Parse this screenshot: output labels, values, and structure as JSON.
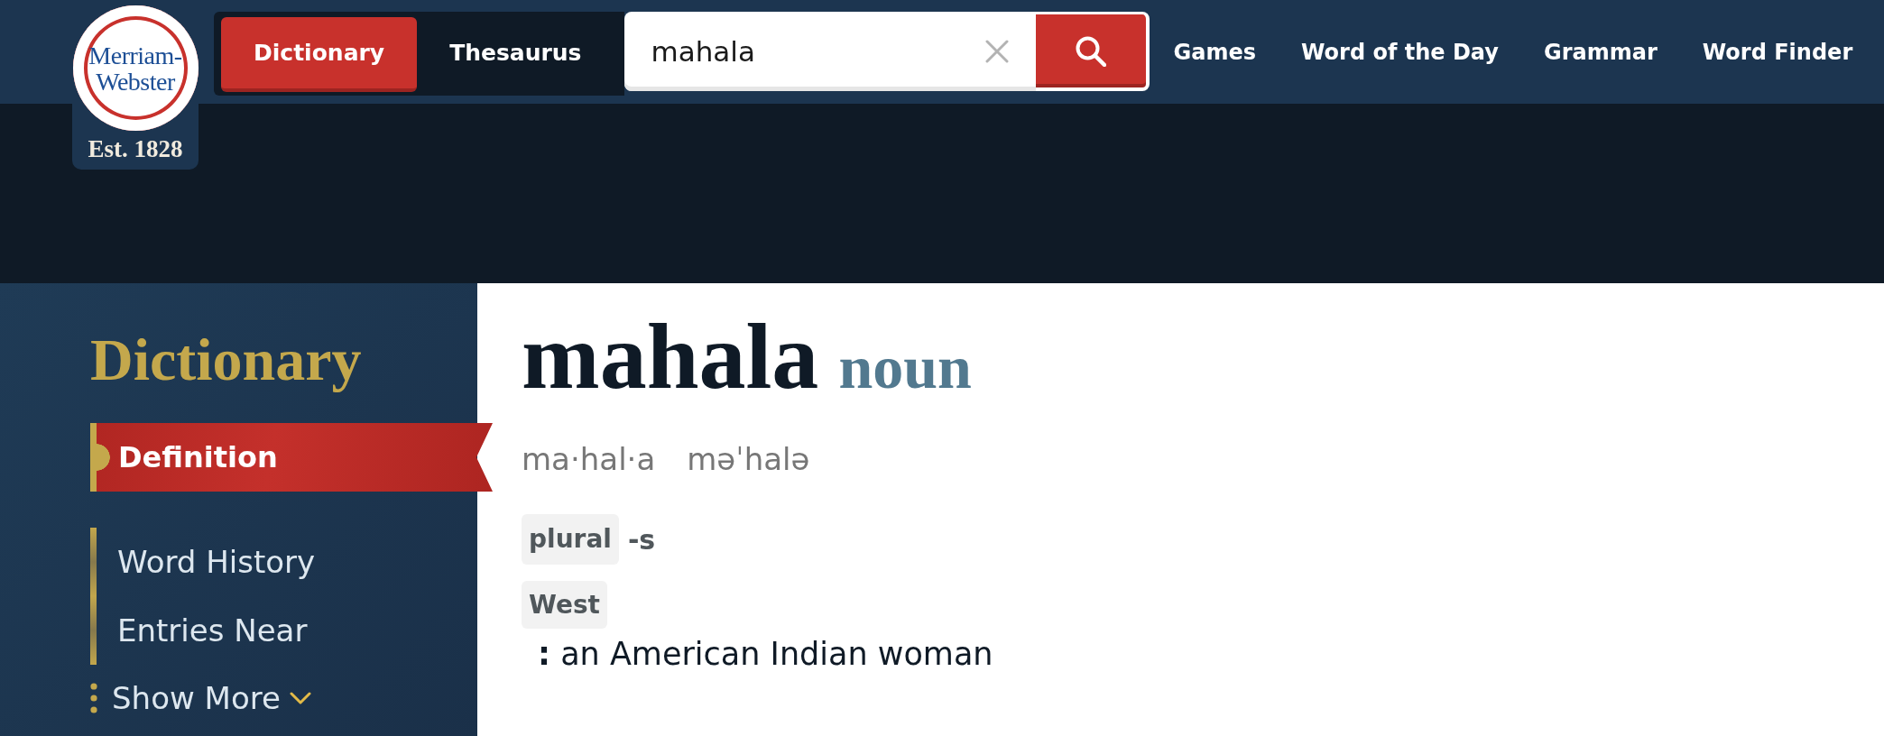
{
  "header": {
    "logo": {
      "wordmark": "Merriam-Webster",
      "tagline": "Est. 1828"
    },
    "tabs": [
      {
        "label": "Dictionary",
        "selected": true
      },
      {
        "label": "Thesaurus",
        "selected": false
      }
    ],
    "search": {
      "value": "mahala"
    },
    "nav_links": [
      "Games",
      "Word of the Day",
      "Grammar",
      "Word Finder"
    ]
  },
  "sidebar": {
    "title": "Dictionary",
    "items": [
      {
        "label": "Definition",
        "selected": true
      },
      {
        "label": "Word History",
        "selected": false
      },
      {
        "label": "Entries Near",
        "selected": false
      }
    ],
    "show_more": "Show More"
  },
  "entry": {
    "headword": "mahala",
    "part_of_speech": "noun",
    "hyphenation": "ma·hal·a",
    "pronunciation": "məˈhalə",
    "inflection": {
      "label": "plural",
      "form": "-s"
    },
    "usage_label": "West",
    "definition": "**:** an American Indian woman"
  }
}
